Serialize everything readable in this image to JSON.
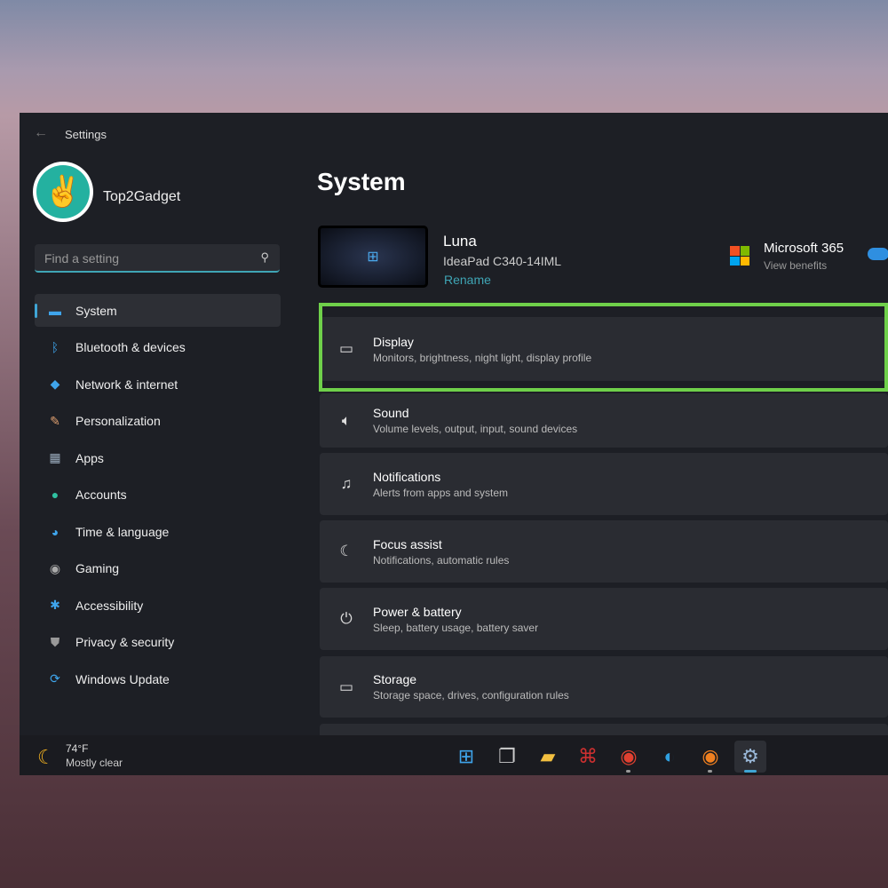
{
  "window": {
    "title": "Settings",
    "back_icon": "arrow-left-icon"
  },
  "user": {
    "name": "Top2Gadget",
    "avatar_icon": "peace-hand-icon"
  },
  "search": {
    "placeholder": "Find a setting",
    "icon": "search-icon"
  },
  "sidebar": {
    "items": [
      {
        "label": "System",
        "icon": "monitor-icon",
        "active": true
      },
      {
        "label": "Bluetooth & devices",
        "icon": "bluetooth-icon"
      },
      {
        "label": "Network & internet",
        "icon": "wifi-icon"
      },
      {
        "label": "Personalization",
        "icon": "brush-icon"
      },
      {
        "label": "Apps",
        "icon": "apps-icon"
      },
      {
        "label": "Accounts",
        "icon": "person-icon"
      },
      {
        "label": "Time & language",
        "icon": "globe-clock-icon"
      },
      {
        "label": "Gaming",
        "icon": "gamepad-icon"
      },
      {
        "label": "Accessibility",
        "icon": "accessibility-icon"
      },
      {
        "label": "Privacy & security",
        "icon": "shield-icon"
      },
      {
        "label": "Windows Update",
        "icon": "update-icon"
      }
    ]
  },
  "main": {
    "title": "System",
    "device": {
      "name": "Luna",
      "model": "IdeaPad C340-14IML",
      "rename": "Rename"
    },
    "ms365": {
      "title": "Microsoft 365",
      "subtitle": "View benefits"
    },
    "cards": [
      {
        "title": "Display",
        "subtitle": "Monitors, brightness, night light, display profile",
        "icon": "laptop-icon",
        "highlighted": true
      },
      {
        "title": "Sound",
        "subtitle": "Volume levels, output, input, sound devices",
        "icon": "speaker-icon"
      },
      {
        "title": "Notifications",
        "subtitle": "Alerts from apps and system",
        "icon": "bell-icon"
      },
      {
        "title": "Focus assist",
        "subtitle": "Notifications, automatic rules",
        "icon": "moon-icon"
      },
      {
        "title": "Power & battery",
        "subtitle": "Sleep, battery usage, battery saver",
        "icon": "power-icon"
      },
      {
        "title": "Storage",
        "subtitle": "Storage space, drives, configuration rules",
        "icon": "drive-icon"
      }
    ]
  },
  "highlight_color": "#6fd04a",
  "taskbar": {
    "weather": {
      "temp": "74°F",
      "condition": "Mostly clear"
    },
    "apps": [
      "start",
      "task-view",
      "file-explorer",
      "acrobat",
      "chrome",
      "edge",
      "chrome-canary",
      "settings"
    ]
  }
}
